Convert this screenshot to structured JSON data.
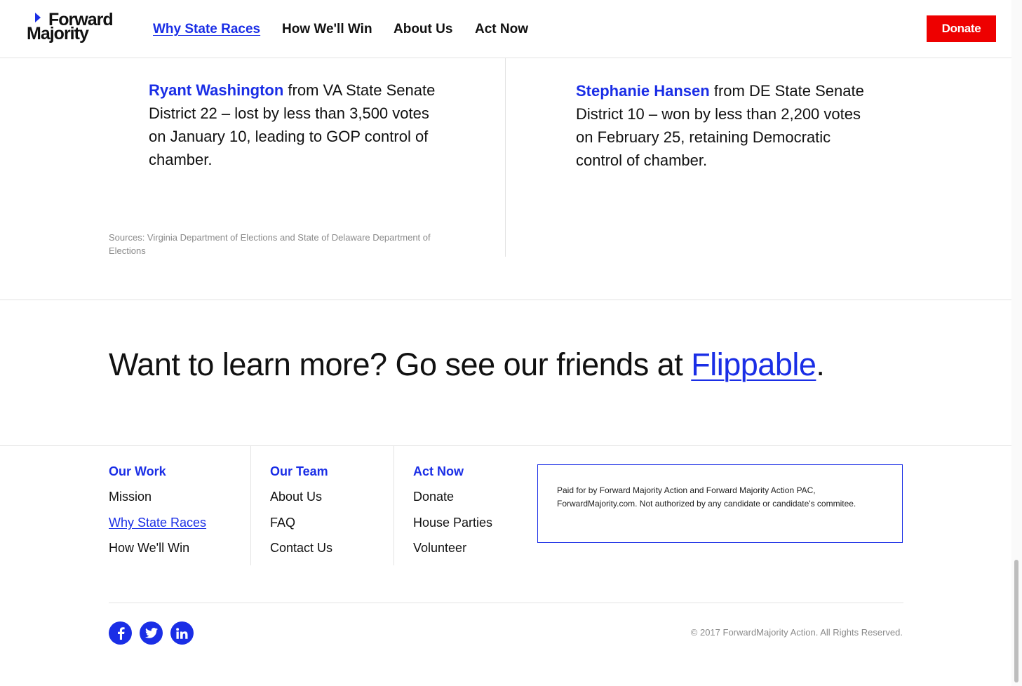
{
  "header": {
    "logo_line1": "Forward",
    "logo_line2": "Majority",
    "nav": [
      {
        "label": "Why State Races",
        "active": true
      },
      {
        "label": "How We'll Win",
        "active": false
      },
      {
        "label": "About Us",
        "active": false
      },
      {
        "label": "Act Now",
        "active": false
      }
    ],
    "donate_label": "Donate"
  },
  "results": [
    {
      "name": "Ryant Washington",
      "text": " from VA State Senate District 22 – lost by less than 3,500 votes on January 10, leading to GOP control of chamber."
    },
    {
      "name": "Stephanie Hansen",
      "text": " from DE State Senate District 10 – won by less than 2,200 votes on February 25, retaining Democratic control of chamber."
    }
  ],
  "sources": "Sources: Virginia Department of Elections and State of Delaware Department of Elections",
  "cta": {
    "text": "Want to learn more? Go see our friends at ",
    "link": "Flippable",
    "suffix": "."
  },
  "footer": {
    "columns": [
      {
        "heading": "Our Work",
        "links": [
          {
            "label": "Mission",
            "active": false
          },
          {
            "label": "Why State Races",
            "active": true
          },
          {
            "label": "How We'll Win",
            "active": false
          }
        ]
      },
      {
        "heading": "Our Team",
        "links": [
          {
            "label": "About Us",
            "active": false
          },
          {
            "label": "FAQ",
            "active": false
          },
          {
            "label": "Contact Us",
            "active": false
          }
        ]
      },
      {
        "heading": "Act Now",
        "links": [
          {
            "label": "Donate",
            "active": false
          },
          {
            "label": "House Parties",
            "active": false
          },
          {
            "label": "Volunteer",
            "active": false
          }
        ]
      }
    ],
    "disclaimer": "Paid for by Forward Majority Action and Forward Majority Action PAC, ForwardMajority.com. Not authorized by any candidate or candidate's commitee.",
    "social": [
      {
        "icon": "facebook-icon"
      },
      {
        "icon": "twitter-icon"
      },
      {
        "icon": "linkedin-icon"
      }
    ],
    "copyright": "© 2017 ForwardMajority Action. All Rights Reserved."
  },
  "colors": {
    "accent": "#1a2ee6",
    "donate": "#ee0000",
    "text": "#111111",
    "muted": "#8a8a8a"
  }
}
